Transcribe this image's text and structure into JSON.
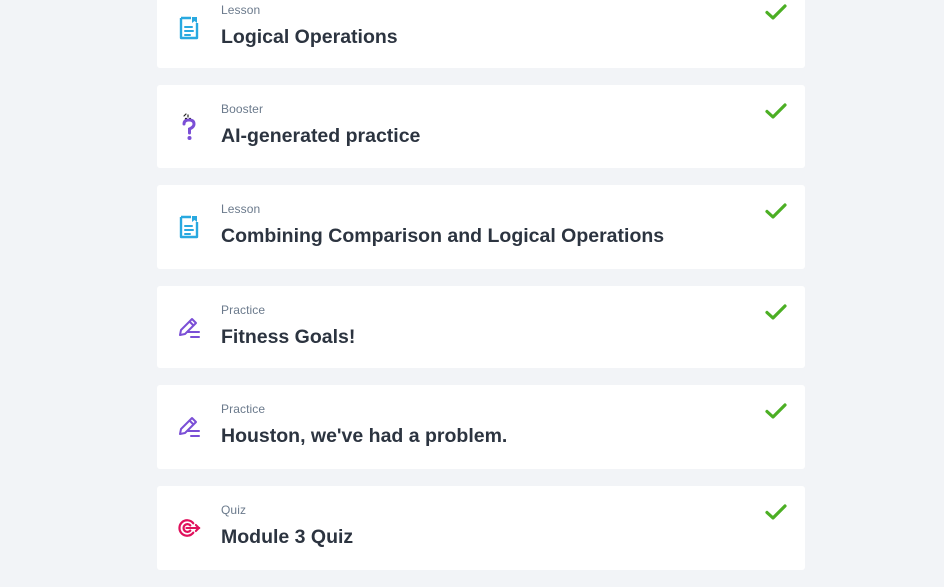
{
  "colors": {
    "background": "#f2f4f7",
    "card": "#ffffff",
    "lesson_icon": "#29a9e0",
    "booster_icon": "#7b4fd6",
    "practice_icon": "#7b4fd6",
    "quiz_icon": "#e0105c",
    "check": "#4caf24"
  },
  "items": [
    {
      "type": "Lesson",
      "title": "Logical Operations",
      "icon": "lesson-doc-icon",
      "completed": true
    },
    {
      "type": "Booster",
      "title": "AI-generated practice",
      "icon": "question-mark-icon",
      "completed": true
    },
    {
      "type": "Lesson",
      "title": "Combining Comparison and Logical Operations",
      "icon": "lesson-doc-icon",
      "completed": true
    },
    {
      "type": "Practice",
      "title": "Fitness Goals!",
      "icon": "pencil-icon",
      "completed": true
    },
    {
      "type": "Practice",
      "title": "Houston, we've had a problem.",
      "icon": "pencil-icon",
      "completed": true
    },
    {
      "type": "Quiz",
      "title": "Module 3 Quiz",
      "icon": "target-icon",
      "completed": true
    }
  ]
}
